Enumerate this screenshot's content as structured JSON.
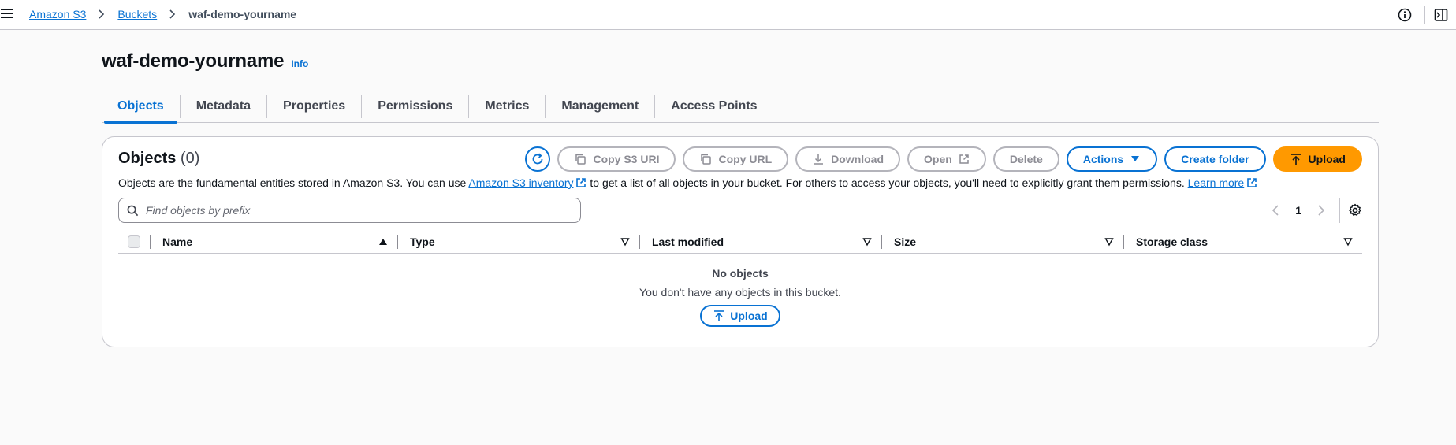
{
  "breadcrumb": {
    "items": [
      "Amazon S3",
      "Buckets"
    ],
    "current": "waf-demo-yourname"
  },
  "page": {
    "title": "waf-demo-yourname",
    "info_label": "Info"
  },
  "tabs": [
    "Objects",
    "Metadata",
    "Properties",
    "Permissions",
    "Metrics",
    "Management",
    "Access Points"
  ],
  "active_tab": "Objects",
  "objects_panel": {
    "title": "Objects",
    "count": "(0)",
    "description_before": "Objects are the fundamental entities stored in Amazon S3. You can use ",
    "inventory_link": "Amazon S3 inventory",
    "description_after": " to get a list of all objects in your bucket. For others to access your objects, you'll need to explicitly grant them permissions. ",
    "learn_more_link": "Learn more",
    "buttons": {
      "copy_s3_uri": "Copy S3 URI",
      "copy_url": "Copy URL",
      "download": "Download",
      "open": "Open",
      "delete": "Delete",
      "actions": "Actions",
      "create_folder": "Create folder",
      "upload": "Upload"
    },
    "search_placeholder": "Find objects by prefix",
    "pagination": {
      "current_page": "1"
    },
    "columns": [
      "Name",
      "Type",
      "Last modified",
      "Size",
      "Storage class"
    ],
    "empty_state": {
      "title": "No objects",
      "description": "You don't have any objects in this bucket.",
      "button": "Upload"
    }
  },
  "colors": {
    "accent": "#0972d3",
    "primary_button": "#ff9900",
    "border": "#c6c6cd",
    "background": "#fafafa"
  }
}
